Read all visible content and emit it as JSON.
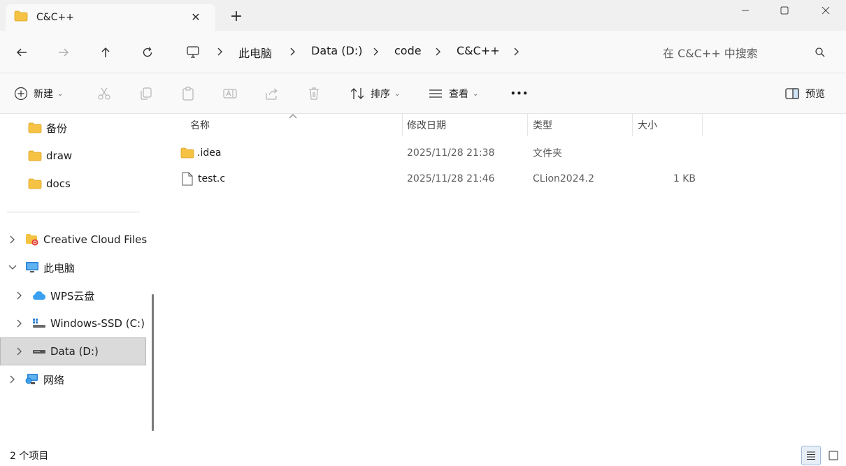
{
  "window": {
    "tab_title": "C&C++",
    "tab_icon": "folder-icon",
    "new_tab_label": "+",
    "controls": [
      "minimize-icon",
      "maximize-icon",
      "close-icon"
    ]
  },
  "address": {
    "breadcrumbs": [
      "此电脑",
      "Data (D:)",
      "code",
      "C&C++"
    ],
    "search_placeholder": "在 C&C++ 中搜索"
  },
  "commands": {
    "new_label": "新建",
    "sort_label": "排序",
    "view_label": "查看",
    "more_label": "•••",
    "preview_label": "预览"
  },
  "sidebar": {
    "quick_folders": [
      "备份",
      "draw",
      "docs"
    ],
    "creative_cloud": "Creative Cloud Files",
    "this_pc": "此电脑",
    "wps": "WPS云盘",
    "windows_ssd": "Windows-SSD (C:)",
    "data_drive": "Data (D:)",
    "network": "网络"
  },
  "columns": {
    "name": "名称",
    "modified": "修改日期",
    "type": "类型",
    "size": "大小"
  },
  "files": [
    {
      "name": ".idea",
      "modified": "2025/11/28 21:38",
      "type": "文件夹",
      "size": "",
      "icon": "folder-icon"
    },
    {
      "name": "test.c",
      "modified": "2025/11/28 21:46",
      "type": "CLion2024.2",
      "size": "1 KB",
      "icon": "file-icon"
    }
  ],
  "status": {
    "item_count": "2 个项目"
  },
  "colors": {
    "folder": "#f5c243",
    "selected_bg": "#dadada",
    "accent": "#0067c0"
  }
}
